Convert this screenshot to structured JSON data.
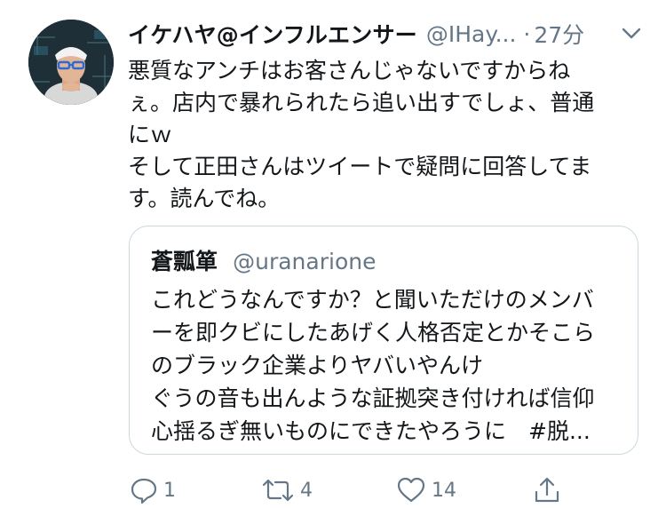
{
  "tweet": {
    "author_name": "イケハヤ@インフルエンサー",
    "handle": "@IHay...",
    "separator": "·",
    "time": "27分",
    "text_lines": [
      "悪質なアンチはお客さんじゃないですからね",
      "ぇ。店内で暴れられたら追い出すでしょ、普通",
      "にｗ",
      "そして正田さんはツイートで疑問に回答してま",
      "す。読んでね。"
    ]
  },
  "quote": {
    "author_name": "蒼瓢箪",
    "handle": "@uranarione",
    "text_lines": [
      "これどうなんですか？と聞いただけのメンバ",
      "ーを即クビにしたあげく人格否定とかそこら",
      "のブラック企業よりヤバいやんけ",
      "ぐうの音も出んような証拠突き付ければ信仰",
      "心揺るぎ無いものにできたやろうに　#脱..."
    ]
  },
  "actions": {
    "reply_count": "1",
    "retweet_count": "4",
    "like_count": "14",
    "share_count": ""
  },
  "icons": {
    "reply": "reply-icon",
    "retweet": "retweet-icon",
    "like": "heart-icon",
    "share": "share-icon",
    "caret": "chevron-down-icon"
  },
  "colors": {
    "text": "#14171a",
    "secondary": "#657786",
    "border": "#ccd6dd",
    "icon": "#657786"
  }
}
